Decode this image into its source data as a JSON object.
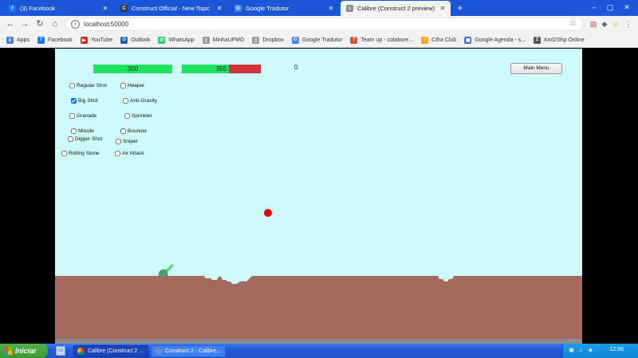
{
  "browser": {
    "tabs": [
      {
        "title": "(3) Facebook",
        "icon": "facebook-icon",
        "color": "#1877f2",
        "glyph": "f",
        "active": false
      },
      {
        "title": "Construct Official - New Topic",
        "icon": "construct-icon",
        "color": "#3a3a3a",
        "glyph": "C",
        "active": false
      },
      {
        "title": "Google Tradutor",
        "icon": "google-translate-icon",
        "color": "#4285f4",
        "glyph": "G",
        "active": false
      },
      {
        "title": "Calibre (Construct 2 preview)",
        "icon": "construct-preview-icon",
        "color": "#8a8a8a",
        "glyph": "c",
        "active": true
      }
    ],
    "new_tab_glyph": "+",
    "window_buttons": [
      "–",
      "▢",
      "✕"
    ],
    "nav": {
      "back": "←",
      "forward": "→",
      "reload": "↻",
      "home": "⌂"
    },
    "address": {
      "url": "localhost:50000",
      "info_glyph": "i",
      "star_glyph": "☆"
    },
    "extensions": [
      {
        "name": "pdf-extension-icon",
        "glyph": "▤",
        "color": "#c44"
      },
      {
        "name": "extension-icon",
        "glyph": "◆",
        "color": "#666"
      },
      {
        "name": "profile-avatar-icon",
        "glyph": "☺",
        "color": "#e0a020"
      },
      {
        "name": "menu-kebab-icon",
        "glyph": "⋮",
        "color": "#555"
      }
    ],
    "bookmarks": [
      {
        "label": "Apps",
        "icon": "apps-grid-icon",
        "color": "#4a7bd8",
        "glyph": "⠿"
      },
      {
        "label": "Facebook",
        "icon": "facebook-icon",
        "color": "#1877f2",
        "glyph": "f"
      },
      {
        "label": "YouTube",
        "icon": "youtube-icon",
        "color": "#e62117",
        "glyph": "▶"
      },
      {
        "label": "Outlook",
        "icon": "outlook-icon",
        "color": "#0a64c8",
        "glyph": "O"
      },
      {
        "label": "WhatsApp",
        "icon": "whatsapp-icon",
        "color": "#25d366",
        "glyph": "✆"
      },
      {
        "label": "MinhaUFMG",
        "icon": "page-icon",
        "color": "#999999",
        "glyph": "▯"
      },
      {
        "label": "Dropbox",
        "icon": "page-icon",
        "color": "#999999",
        "glyph": "▯"
      },
      {
        "label": "Google Tradutor",
        "icon": "google-translate-icon",
        "color": "#4285f4",
        "glyph": "G"
      },
      {
        "label": "Team up - colabore...",
        "icon": "teamup-icon",
        "color": "#e84b2a",
        "glyph": "T"
      },
      {
        "label": "Cifra Club",
        "icon": "cifraclub-icon",
        "color": "#f5a623",
        "glyph": "♪"
      },
      {
        "label": "Google Agenda - s...",
        "icon": "google-calendar-icon",
        "color": "#3b6fd8",
        "glyph": "▦"
      },
      {
        "label": "Kml2Shp Online",
        "icon": "kml2shp-icon",
        "color": "#555555",
        "glyph": "Z"
      }
    ]
  },
  "game": {
    "bars": [
      {
        "value": "300",
        "fraction": 1.0
      },
      {
        "value": "355",
        "fraction": 0.6
      }
    ],
    "score": "0",
    "main_menu_label": "Main Menu",
    "colors": {
      "sky": "#cdfbfb",
      "ground": "#a46a5e",
      "hp_fill": "#1ee25f",
      "hp_empty": "#d0323c",
      "projectile": "#e60000",
      "tank": "#4a9e6a",
      "barrel": "#4cd672"
    },
    "weapons": [
      {
        "label": "Regular Shot",
        "checked": false
      },
      {
        "label": "Heaper",
        "checked": false
      },
      {
        "label": "Big Shot",
        "checked": true
      },
      {
        "label": "Anti-Gravity",
        "checked": false
      },
      {
        "label": "Granade",
        "checked": false
      },
      {
        "label": "Sprinkler",
        "checked": false
      },
      {
        "label": "Missile",
        "checked": false
      },
      {
        "label": "Bouncer",
        "checked": false
      },
      {
        "label": "Digger Shot",
        "checked": false
      },
      {
        "label": "Sniper",
        "checked": false
      },
      {
        "label": "Rolling Stone",
        "checked": false
      },
      {
        "label": "Air Attack",
        "checked": false
      }
    ]
  },
  "taskbar": {
    "start_label": "Iniciar",
    "quick_launch_icon": "show-desktop-icon",
    "tasks": [
      {
        "label": "Calibre (Construct 2 ...",
        "icon": "chrome-icon",
        "active": true
      },
      {
        "label": "Construct 2 - Calibre...",
        "icon": "construct-icon",
        "active": false
      }
    ],
    "clock": "12:56"
  }
}
